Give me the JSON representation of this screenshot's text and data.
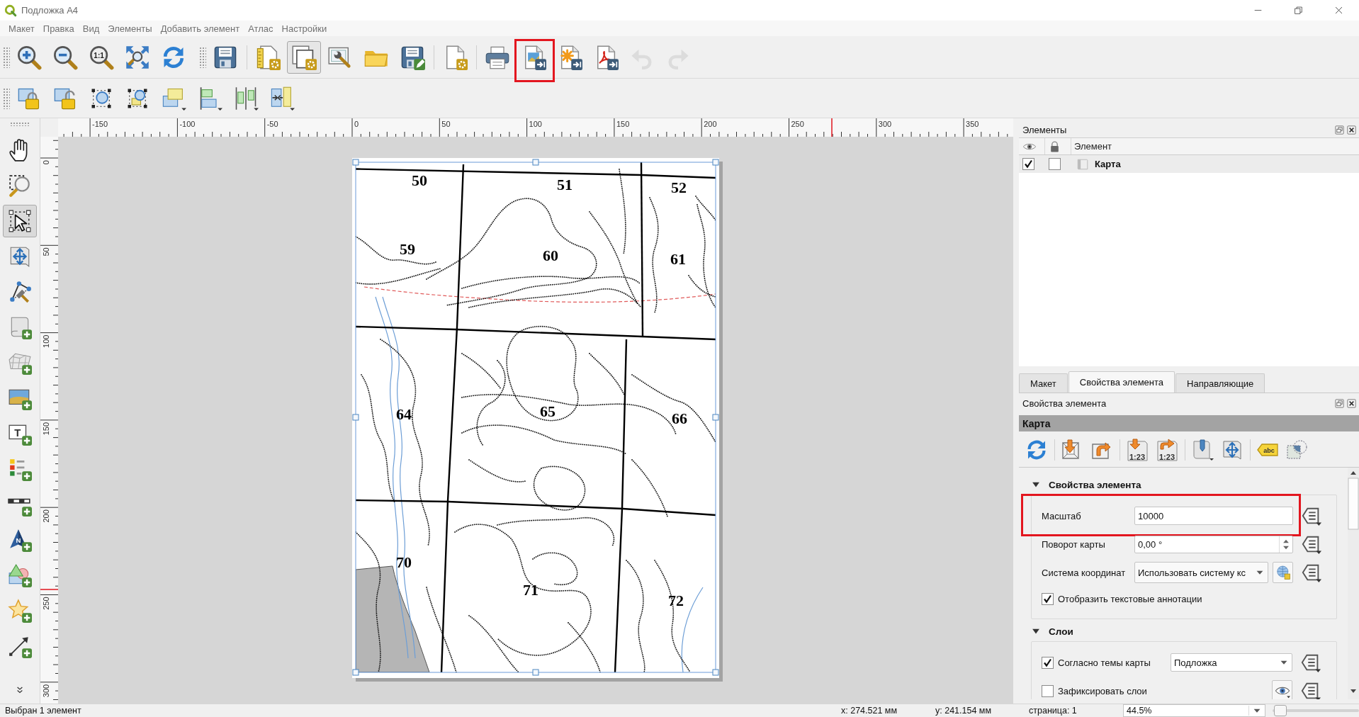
{
  "window": {
    "title": "Подложка A4"
  },
  "menu": [
    "Макет",
    "Правка",
    "Вид",
    "Элементы",
    "Добавить элемент",
    "Атлас",
    "Настройки"
  ],
  "toolbar_rows": [
    [
      {
        "groups": [
          [
            {
              "disabled": false,
              "pressed": false,
              "highlighted": false
            },
            {
              "disabled": false,
              "pressed": false,
              "highlighted": false
            },
            {
              "disabled": false,
              "pressed": false,
              "highlighted": false,
              "glyph": "1:1"
            },
            {
              "disabled": false,
              "pressed": false,
              "highlighted": false
            },
            {
              "disabled": false,
              "pressed": false,
              "highlighted": false
            }
          ]
        ]
      },
      {
        "groups": [
          [
            {
              "disabled": false,
              "pressed": false,
              "highlighted": false
            }
          ],
          [
            {
              "disabled": false,
              "pressed": false,
              "highlighted": false
            },
            {
              "disabled": false,
              "pressed": true,
              "highlighted": false
            },
            {
              "disabled": false,
              "pressed": false,
              "highlighted": false
            },
            {
              "disabled": false,
              "pressed": false,
              "highlighted": false
            },
            {
              "disabled": false,
              "pressed": false,
              "highlighted": false
            }
          ],
          [
            {
              "disabled": false,
              "pressed": false,
              "highlighted": false
            }
          ],
          [
            {
              "disabled": false,
              "pressed": false,
              "highlighted": false
            },
            {
              "disabled": false,
              "pressed": false,
              "highlighted": true
            },
            {
              "disabled": false,
              "pressed": false,
              "highlighted": false
            },
            {
              "disabled": false,
              "pressed": false,
              "highlighted": false
            },
            {
              "disabled": true,
              "pressed": false,
              "highlighted": false
            },
            {
              "disabled": true,
              "pressed": false,
              "highlighted": false
            }
          ]
        ]
      }
    ],
    [
      {
        "groups": [
          [
            {
              "disabled": false,
              "pressed": false,
              "highlighted": false
            },
            {
              "disabled": false,
              "pressed": false,
              "highlighted": false
            },
            {
              "disabled": false,
              "pressed": false,
              "highlighted": false
            },
            {
              "disabled": false,
              "pressed": false,
              "highlighted": false
            },
            {
              "disabled": false,
              "pressed": false,
              "highlighted": false
            },
            {
              "disabled": false,
              "pressed": false,
              "highlighted": false
            },
            {
              "disabled": false,
              "pressed": false,
              "highlighted": false
            },
            {
              "disabled": false,
              "pressed": false,
              "highlighted": false
            }
          ]
        ]
      }
    ]
  ],
  "tools": [
    {
      "selected": false
    },
    {
      "selected": false
    },
    {
      "selected": true
    },
    {
      "selected": false
    },
    {
      "selected": false
    },
    {
      "selected": false
    },
    {
      "selected": false
    },
    {
      "selected": false
    },
    {
      "selected": false,
      "glyph": "T"
    },
    {
      "selected": false
    },
    {
      "selected": false
    },
    {
      "selected": false,
      "glyph": "N"
    },
    {
      "selected": false
    },
    {
      "selected": false
    },
    {
      "selected": false
    }
  ],
  "rulers": {
    "horizontal": [
      "-150",
      "-100",
      "-50",
      "0",
      "50",
      "100",
      "150",
      "200",
      "250",
      "300",
      "350"
    ],
    "vertical": [
      "0",
      "50",
      "100",
      "150",
      "200",
      "250",
      "300"
    ]
  },
  "layout": {
    "map": {
      "selected": true,
      "block_labels": [
        "50",
        "51",
        "52",
        "59",
        "60",
        "61",
        "64",
        "65",
        "66",
        "70",
        "71",
        "72"
      ]
    }
  },
  "items_panel": {
    "title": "Элементы",
    "header": "Элемент",
    "rows": [
      {
        "name": "Карта",
        "visible": true,
        "locked": false,
        "selected": true
      }
    ]
  },
  "tabs": [
    {
      "label": "Макет",
      "selected": false
    },
    {
      "label": "Свойства элемента",
      "selected": true
    },
    {
      "label": "Направляющие",
      "selected": false
    }
  ],
  "properties": {
    "title": "Свойства элемента",
    "item": "Карта",
    "toolbar": {
      "groups": [
        [
          {
            "disabled": false
          }
        ],
        [
          {
            "disabled": false
          },
          {
            "disabled": false
          }
        ],
        [
          {
            "disabled": false,
            "glyph": "1:23"
          },
          {
            "disabled": false,
            "glyph": "1:23"
          }
        ],
        [
          {
            "disabled": false
          },
          {
            "disabled": false
          }
        ],
        [
          {
            "disabled": false,
            "glyph": "abc"
          },
          {
            "disabled": false
          }
        ]
      ]
    },
    "sections": [
      {
        "title": "Свойства элемента",
        "expanded": true,
        "rows": [
          {
            "kind": "text",
            "label": "Масштаб",
            "value": "10000",
            "highlighted": true
          },
          {
            "kind": "spin",
            "label": "Поворот карты",
            "value": "0,00 °",
            "highlighted": false
          },
          {
            "kind": "combobutton",
            "label": "Система координат",
            "value": "Использовать систему кс",
            "highlighted": false
          },
          {
            "kind": "check",
            "label": "Отобразить текстовые аннотации",
            "checked": true,
            "highlighted": false
          }
        ]
      },
      {
        "title": "Слои",
        "expanded": true,
        "rows": [
          {
            "kind": "checkcombo",
            "label": "Согласно темы карты",
            "checked": true,
            "value": "Подложка",
            "highlighted": false
          },
          {
            "kind": "checkbutton",
            "label": "Зафиксировать слои",
            "checked": false,
            "highlighted": false
          }
        ]
      }
    ]
  },
  "status_bar": {
    "message": "Выбран 1 элемент",
    "x": "x: 274.521 мм",
    "y": "y: 241.154 мм",
    "page": "страница: 1",
    "zoom": "44.5%",
    "zoom_slider": {
      "level": 0.02
    }
  }
}
